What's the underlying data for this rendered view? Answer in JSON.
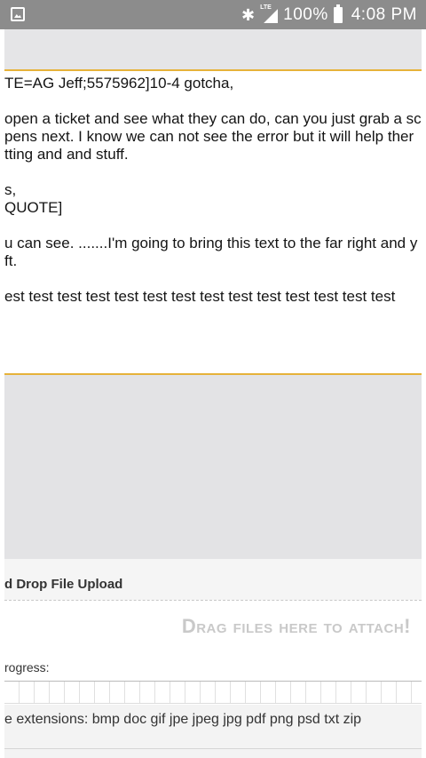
{
  "status_bar": {
    "battery": "100%",
    "time": "4:08 PM",
    "network": "LTE"
  },
  "editor": {
    "lines": [
      "TE=AG Jeff;5575962]10-4 gotcha,",
      "open a ticket and see what they can do, can you just grab a scr",
      "pens next.  I know we can not see the error but it will help ther",
      "tting and and stuff.",
      "s,",
      "QUOTE]",
      "u can see. .......I'm going to bring this text to the far right and y",
      "ft.",
      "est test test test test test test test test test test test test test"
    ]
  },
  "upload": {
    "title": "d Drop File Upload",
    "drop_text": "Drag files here to attach!",
    "progress_label": "rogress:",
    "progress_fraction": 0,
    "extensions_text": "e extensions: bmp doc gif jpe jpeg jpg pdf png psd txt zip"
  },
  "colors": {
    "accent": "#e6b23a",
    "status_bar": "#8c8c8c",
    "panel_gray": "#e3e3e5"
  },
  "icons": [
    "image-notification-icon",
    "bluetooth-icon",
    "lte-signal-icon",
    "battery-icon"
  ]
}
